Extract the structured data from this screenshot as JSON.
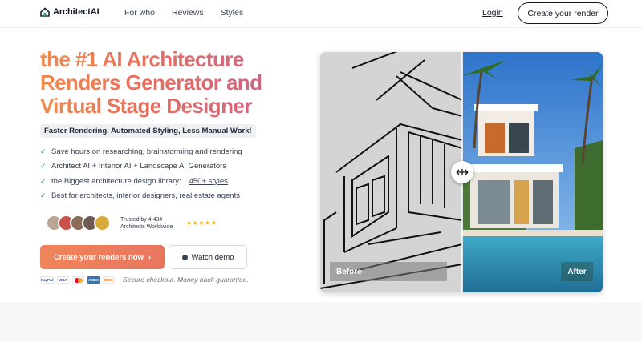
{
  "nav": {
    "logo_text": "ArchitectAI",
    "links": [
      "For who",
      "Reviews",
      "Styles"
    ],
    "login": "Login",
    "cta": "Create your render"
  },
  "hero": {
    "headline": "the #1 AI Architecture Renders Generator and Virtual Stage Designer",
    "tagline": "Faster Rendering, Automated Styling, Less Manual Work!",
    "features": [
      "Save hours on researching, brainstorming and rendering",
      "Architect AI + Interior AI + Landscape AI Generators",
      "the Biggest architecture design library:",
      "Best for architects, interior designers, real estate agents"
    ],
    "styles_link": "450+ styles",
    "trusted_line1": "Trusted by 4,434",
    "trusted_line2": "Architects Worldwide",
    "stars": "★★★★★",
    "cta_main": "Create your renders now",
    "cta_demo": "Watch demo",
    "payments": [
      "PayPal",
      "VISA",
      "Mastercard",
      "AMEX",
      "Discover"
    ],
    "payments_text": [
      "PayPal",
      "VISA",
      "",
      "AMEX",
      "DISC"
    ],
    "secure_text": "Secure checkout. Money back guarantee."
  },
  "compare": {
    "before_label": "Before",
    "after_label": "After"
  },
  "colors": {
    "accent_orange": "#f0845a",
    "headline_gradient": [
      "#f28a4a",
      "#e8705d",
      "#c9618a"
    ],
    "check_green": "#22a06b",
    "star_gold": "#f5b400"
  },
  "icons": [
    "house-logo-icon",
    "check-icon",
    "chevron-right-icon",
    "play-icon",
    "drag-arrows-icon"
  ]
}
